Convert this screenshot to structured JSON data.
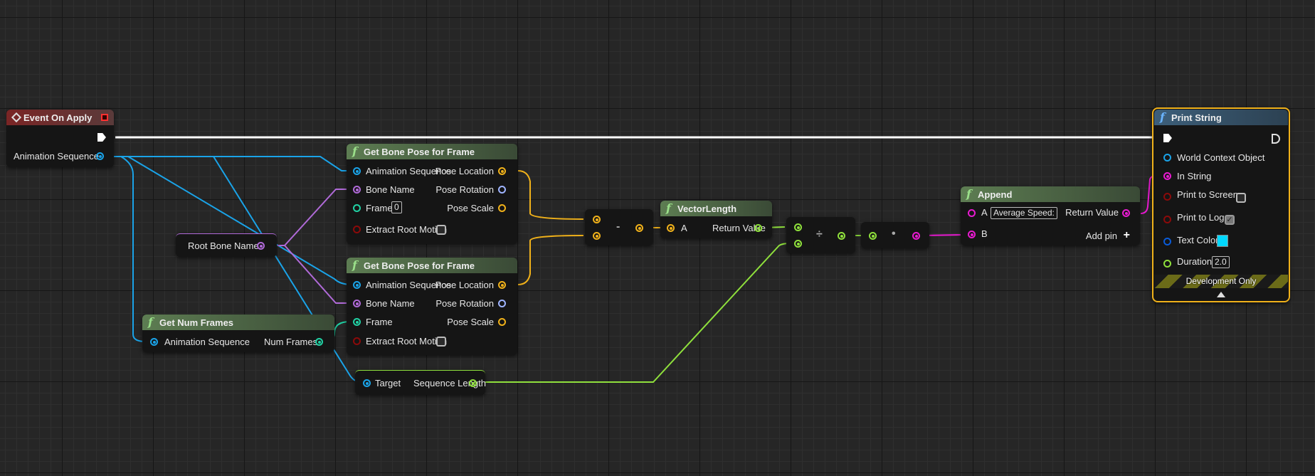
{
  "colors": {
    "object": "#1aa3e8",
    "name": "#b06ad8",
    "int": "#21d1a4",
    "bool": "#8b0a0a",
    "vector": "#f0b11a",
    "rotator": "#9fb4ff",
    "float": "#8fe03c",
    "string": "#e81ad0",
    "struct": "#0a5bd8",
    "selected": "#f0b11a"
  },
  "event": {
    "title": "Event On Apply",
    "output": "Animation Sequence"
  },
  "root_bone": {
    "label": "Root Bone Name"
  },
  "num_frames": {
    "title": "Get Num Frames",
    "input": "Animation Sequence",
    "output": "Num Frames"
  },
  "bone_pose_1": {
    "title": "Get Bone Pose for Frame",
    "inputs": [
      "Animation Sequence",
      "Bone Name",
      "Frame",
      "Extract Root Motion"
    ],
    "outputs": [
      "Pose Location",
      "Pose Rotation",
      "Pose Scale"
    ],
    "frame_value": "0",
    "extract_root_motion": false
  },
  "bone_pose_2": {
    "title": "Get Bone Pose for Frame",
    "inputs": [
      "Animation Sequence",
      "Bone Name",
      "Frame",
      "Extract Root Motion"
    ],
    "outputs": [
      "Pose Location",
      "Pose Rotation",
      "Pose Scale"
    ],
    "extract_root_motion": false
  },
  "seq_length": {
    "input": "Target",
    "output": "Sequence Length"
  },
  "subtract": {
    "symbol": "-"
  },
  "vector_length": {
    "title": "VectorLength",
    "input": "A",
    "output": "Return Value"
  },
  "divide": {
    "symbol": "÷"
  },
  "convert": {
    "symbol": "•"
  },
  "append": {
    "title": "Append",
    "a_label": "A",
    "a_value": "Average Speed:",
    "b_label": "B",
    "output": "Return Value",
    "add_pin": "Add pin"
  },
  "print_string": {
    "title": "Print String",
    "inputs": [
      "World Context Object",
      "In String",
      "Print to Screen",
      "Print to Log",
      "Text Color",
      "Duration"
    ],
    "print_to_screen": false,
    "print_to_log": true,
    "text_color": "#00d8ff",
    "duration": "2.0",
    "footer": "Development Only"
  }
}
